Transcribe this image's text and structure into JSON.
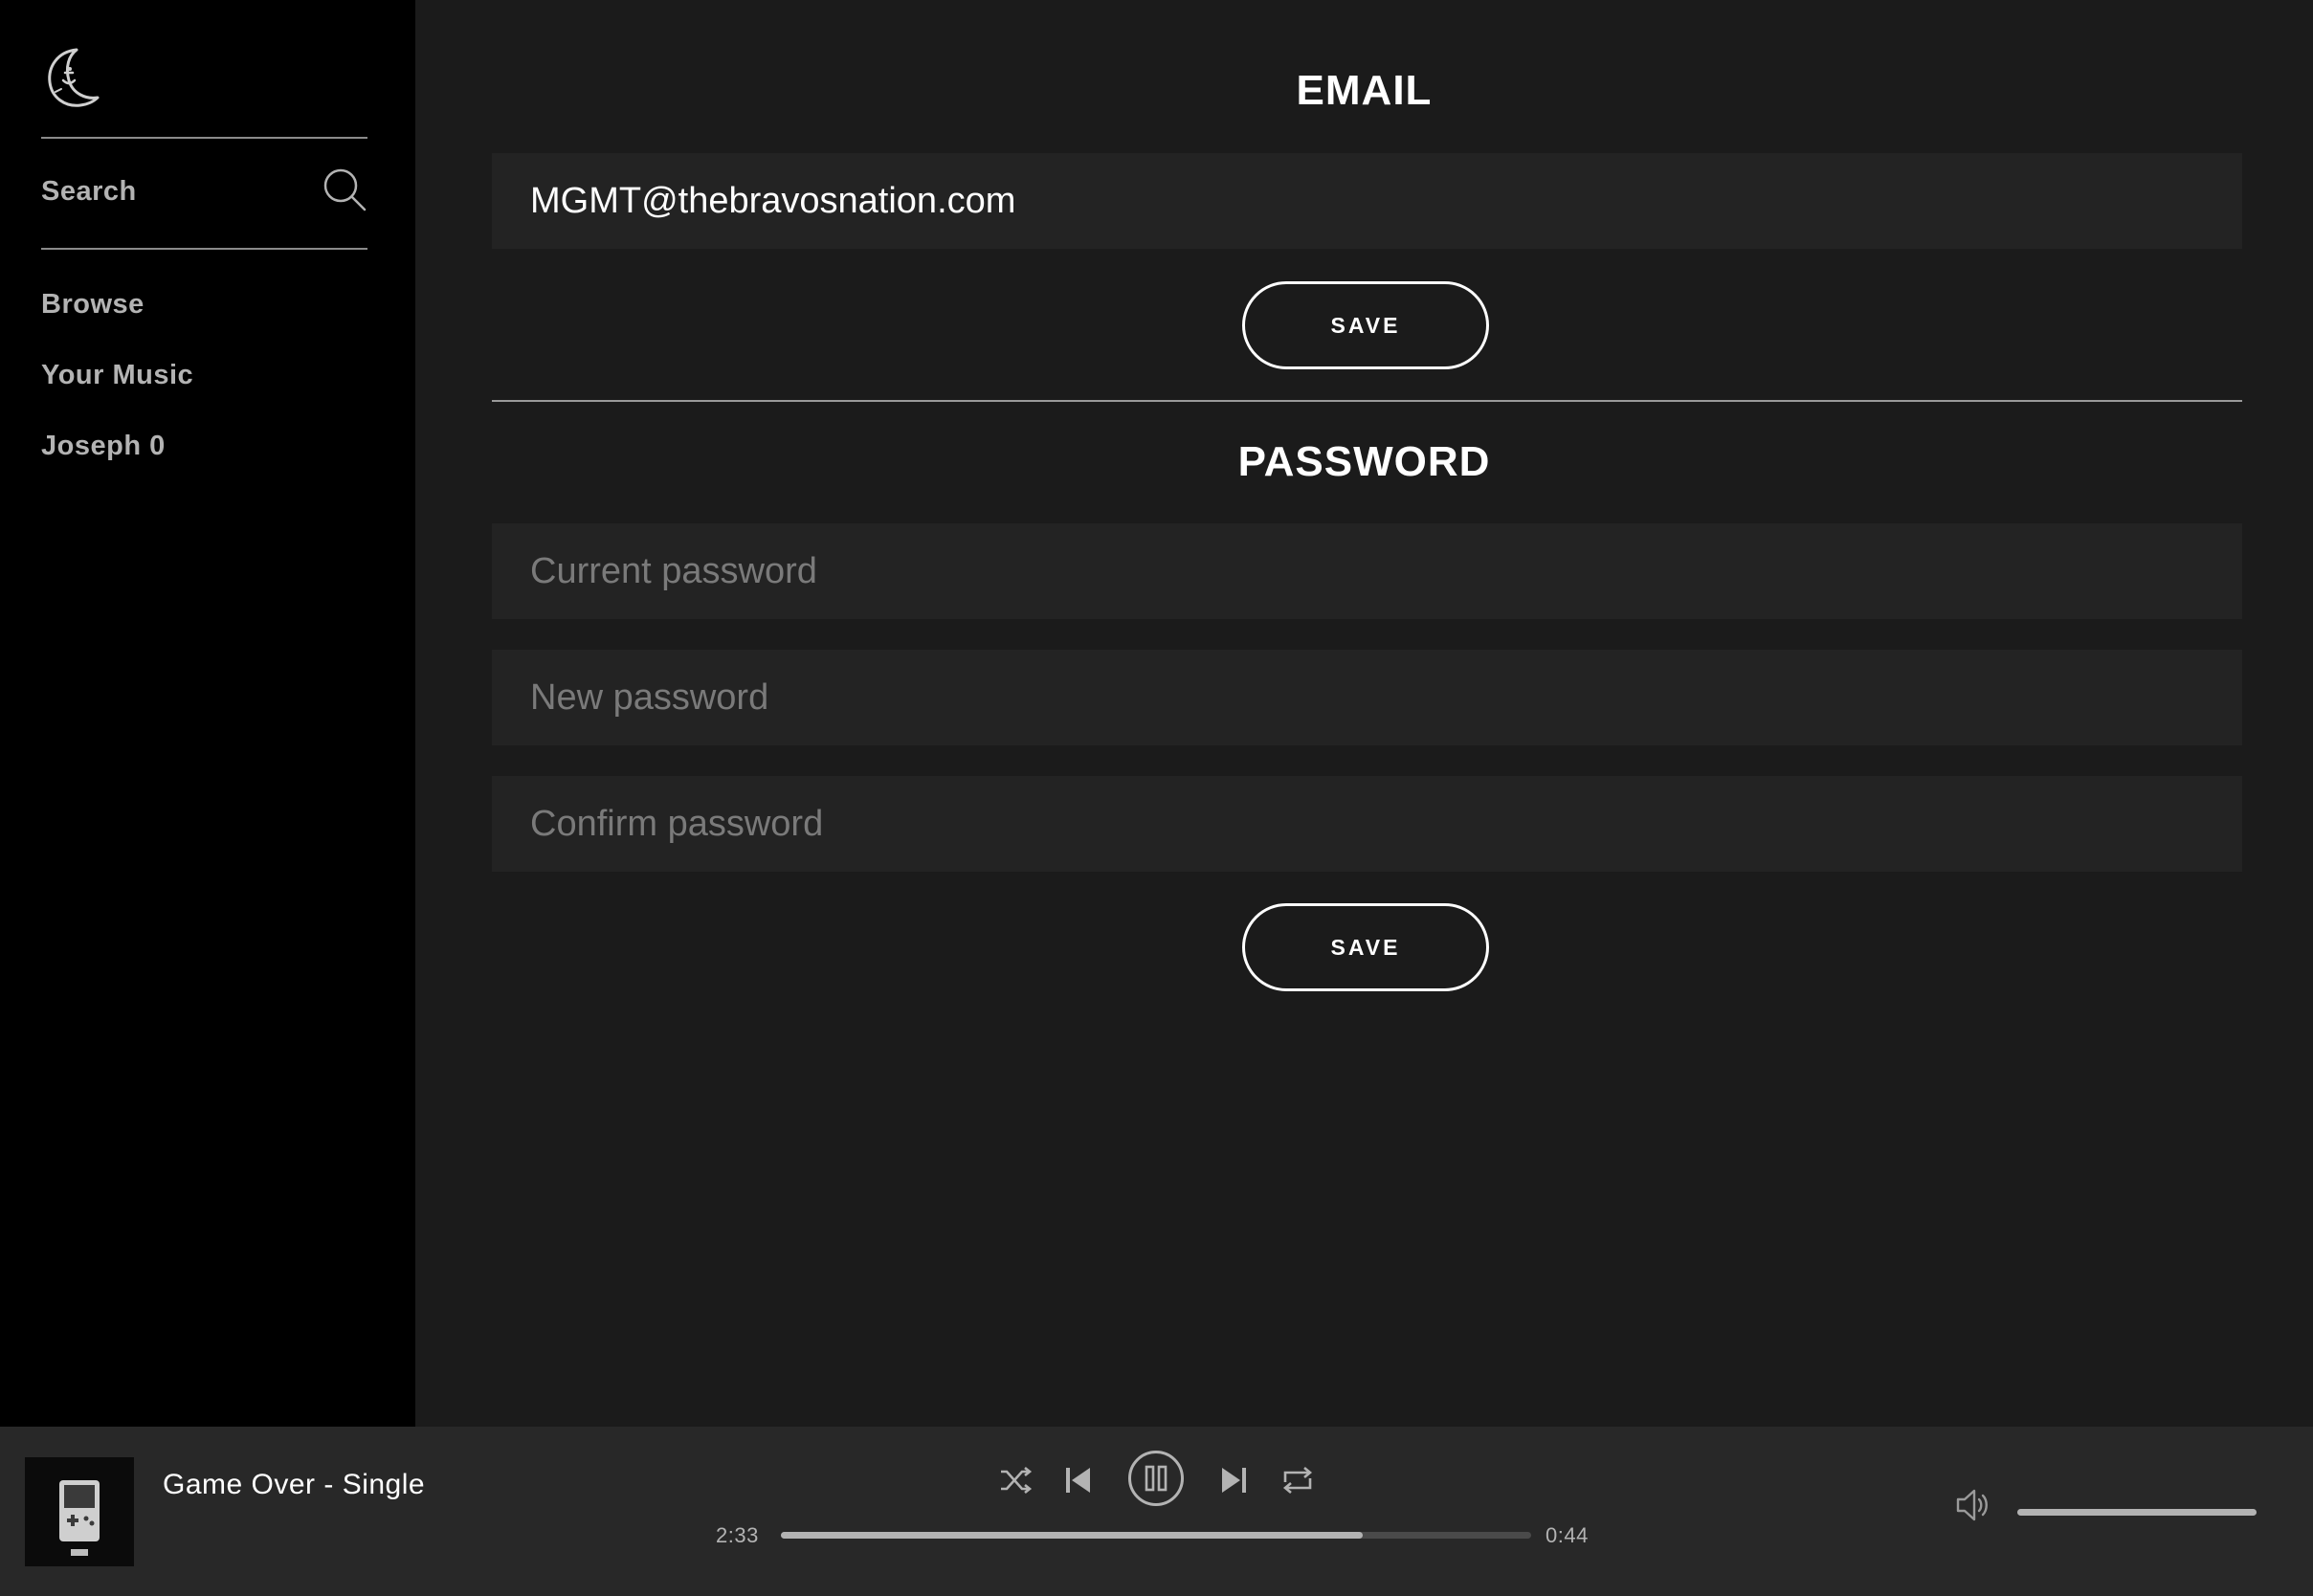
{
  "app": {
    "logo_icon": "moon-face-icon"
  },
  "sidebar": {
    "search_label": "Search",
    "nav_items": [
      {
        "label": "Browse"
      },
      {
        "label": "Your Music"
      },
      {
        "label": "Joseph 0"
      }
    ]
  },
  "email_section": {
    "title": "EMAIL",
    "email_value": "MGMT@thebravosnation.com",
    "save_label": "SAVE"
  },
  "password_section": {
    "title": "PASSWORD",
    "current_placeholder": "Current password",
    "new_placeholder": "New password",
    "confirm_placeholder": "Confirm password",
    "save_label": "SAVE"
  },
  "player": {
    "track_title": "Game Over - Single",
    "elapsed": "2:33",
    "remaining": "0:44",
    "progress_fraction": 0.776,
    "volume_fraction": 1.0,
    "state": "playing",
    "controls": [
      "shuffle-icon",
      "previous-icon",
      "pause-icon",
      "next-icon",
      "repeat-icon"
    ],
    "volume_icon": "speaker-icon"
  },
  "colors": {
    "sidebar_bg": "#000000",
    "main_bg": "#1b1b1b",
    "field_bg": "#232323",
    "player_bg": "#282828",
    "muted_text": "#b3b3b3"
  }
}
